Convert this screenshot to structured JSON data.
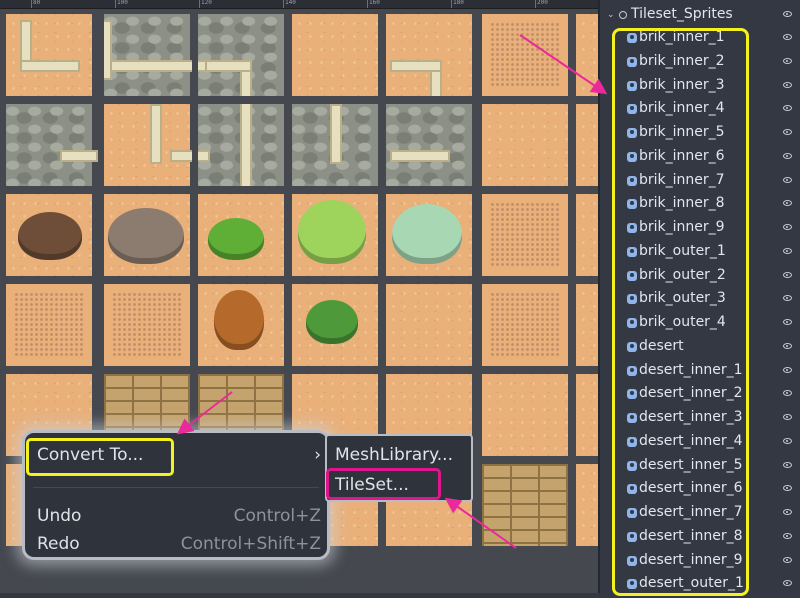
{
  "ruler": {
    "ticks": [
      "80",
      "100",
      "120",
      "140",
      "160",
      "180",
      "200",
      "220",
      "240"
    ]
  },
  "context_menu": {
    "convert_label": "Convert To...",
    "convert_arrow": "›",
    "undo_label": "Undo",
    "undo_shortcut": "Control+Z",
    "redo_label": "Redo",
    "redo_shortcut": "Control+Shift+Z"
  },
  "submenu": {
    "mesh_label": "MeshLibrary...",
    "tileset_label": "TileSet..."
  },
  "scene_tree": {
    "root": "Tileset_Sprites",
    "nodes": [
      "brik_inner_1",
      "brik_inner_2",
      "brik_inner_3",
      "brik_inner_4",
      "brik_inner_5",
      "brik_inner_6",
      "brik_inner_7",
      "brik_inner_8",
      "brik_inner_9",
      "brik_outer_1",
      "brik_outer_2",
      "brik_outer_3",
      "brik_outer_4",
      "desert",
      "desert_inner_1",
      "desert_inner_2",
      "desert_inner_3",
      "desert_inner_4",
      "desert_inner_5",
      "desert_inner_6",
      "desert_inner_7",
      "desert_inner_8",
      "desert_inner_9",
      "desert_outer_1"
    ]
  },
  "colors": {
    "highlight_yellow": "#f4f21e",
    "highlight_magenta": "#e0148c",
    "arrow": "#ea2a9b",
    "node_icon": "#8fb5ea",
    "panel_bg": "#333842"
  },
  "icons": {
    "node": "sprite-node-icon",
    "visibility": "eye-icon",
    "submenu": "chevron-right-icon"
  }
}
